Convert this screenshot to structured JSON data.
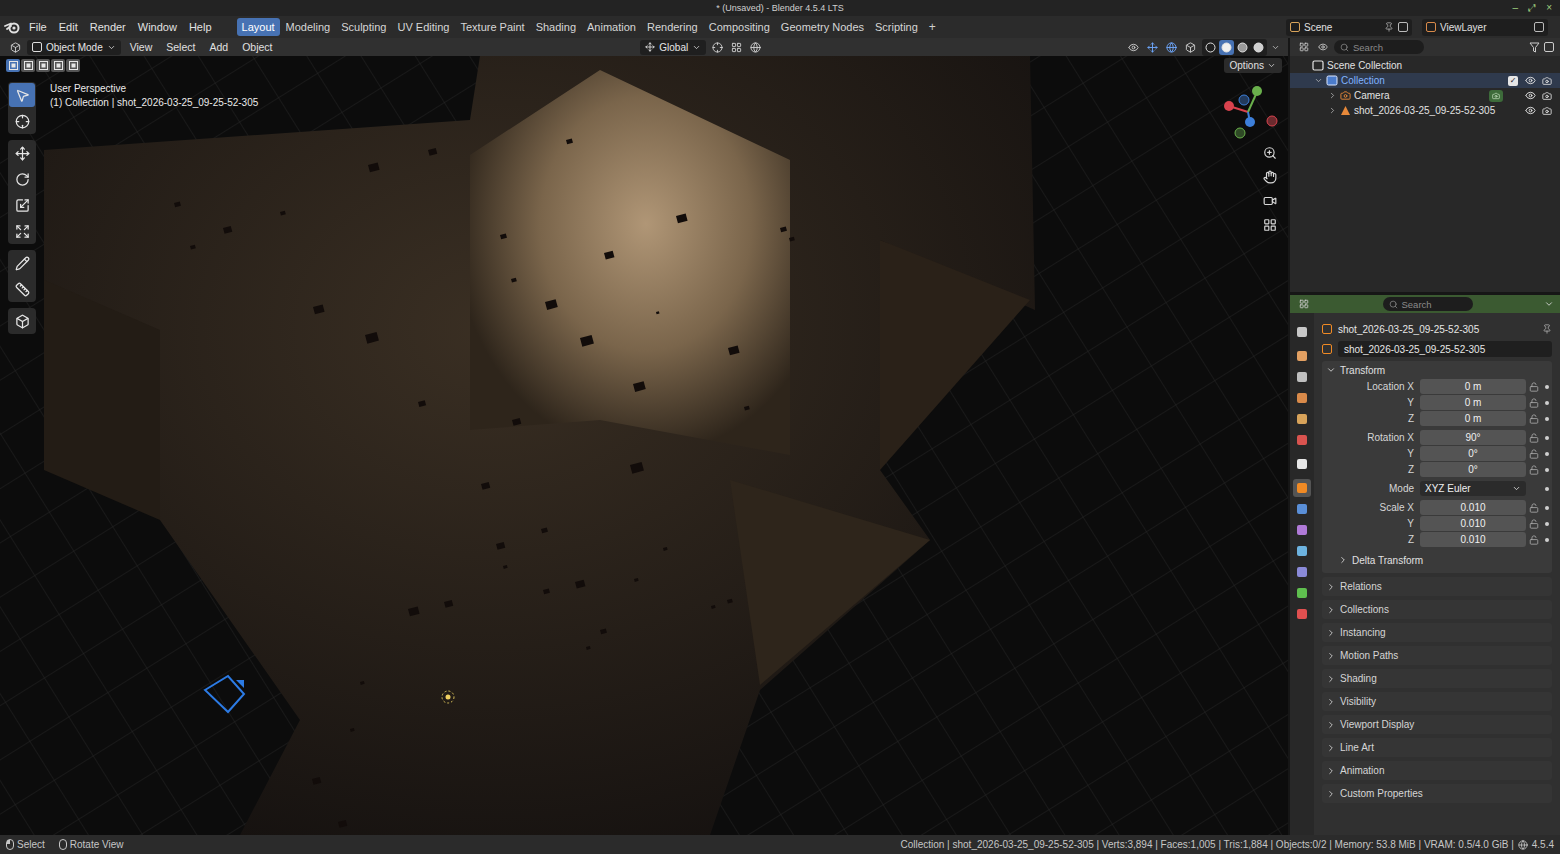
{
  "window": {
    "title": "* (Unsaved) - Blender 4.5.4 LTS",
    "controls": [
      "–",
      "⤢",
      "×"
    ]
  },
  "menubar": {
    "items": [
      "File",
      "Edit",
      "Render",
      "Window",
      "Help"
    ]
  },
  "workspace_tabs": [
    {
      "label": "Layout",
      "selected": true
    },
    {
      "label": "Modeling",
      "selected": false
    },
    {
      "label": "Sculpting",
      "selected": false
    },
    {
      "label": "UV Editing",
      "selected": false
    },
    {
      "label": "Texture Paint",
      "selected": false
    },
    {
      "label": "Shading",
      "selected": false
    },
    {
      "label": "Animation",
      "selected": false
    },
    {
      "label": "Rendering",
      "selected": false
    },
    {
      "label": "Compositing",
      "selected": false
    },
    {
      "label": "Geometry Nodes",
      "selected": false
    },
    {
      "label": "Scripting",
      "selected": false
    }
  ],
  "add_workspace": "+",
  "scene_selector": {
    "scene": "Scene",
    "view_layer": "ViewLayer"
  },
  "viewport": {
    "mode": "Object Mode",
    "menus": [
      "View",
      "Select",
      "Add",
      "Object"
    ],
    "orientation": "Global",
    "options": "Options",
    "view_name": "User Perspective",
    "context": "(1) Collection | shot_2026-03-25_09-25-52-305",
    "select_modes": [
      {
        "selected": true
      },
      {
        "selected": false
      },
      {
        "selected": false
      },
      {
        "selected": false
      },
      {
        "selected": false
      }
    ],
    "tool_groups": [
      [
        {
          "kind": "select-box",
          "selected": true
        },
        {
          "kind": "cursor",
          "selected": false
        }
      ],
      [
        {
          "kind": "move",
          "selected": false
        },
        {
          "kind": "rotate",
          "selected": false
        },
        {
          "kind": "scale",
          "selected": false
        },
        {
          "kind": "transform",
          "selected": false
        }
      ],
      [
        {
          "kind": "annotate",
          "selected": false
        },
        {
          "kind": "measure",
          "selected": false
        }
      ],
      [
        {
          "kind": "add-cube",
          "selected": false
        }
      ]
    ],
    "navigation": [
      {
        "kind": "zoom"
      },
      {
        "kind": "pan"
      },
      {
        "kind": "camera"
      },
      {
        "kind": "ortho"
      }
    ],
    "shading_modes": [
      {
        "kind": "wireframe",
        "selected": false
      },
      {
        "kind": "solid",
        "selected": true
      },
      {
        "kind": "material",
        "selected": false
      },
      {
        "kind": "rendered",
        "selected": false
      }
    ]
  },
  "outliner": {
    "search_placeholder": "Search",
    "rows": [
      {
        "label": "Scene Collection",
        "depth": 0,
        "kind": "scene-collection",
        "expandable": false,
        "expanded": false,
        "selected": false,
        "toggles": false,
        "has_include": false,
        "included": false,
        "visible": false,
        "renderable": false,
        "data_badge": false
      },
      {
        "label": "Collection",
        "depth": 1,
        "kind": "collection",
        "expandable": true,
        "expanded": true,
        "selected": true,
        "toggles": true,
        "has_include": true,
        "included": true,
        "visible": true,
        "renderable": true,
        "data_badge": false
      },
      {
        "label": "Camera",
        "depth": 2,
        "kind": "camera",
        "expandable": true,
        "expanded": false,
        "selected": false,
        "toggles": true,
        "has_include": false,
        "included": false,
        "visible": true,
        "renderable": true,
        "data_badge": true
      },
      {
        "label": "shot_2026-03-25_09-25-52-305",
        "depth": 2,
        "kind": "mesh",
        "expandable": true,
        "expanded": false,
        "selected": false,
        "toggles": true,
        "has_include": false,
        "included": false,
        "visible": true,
        "renderable": true,
        "data_badge": false
      }
    ]
  },
  "properties": {
    "search_placeholder": "Search",
    "tab_groups": [
      [
        {
          "kind": "tool",
          "color": "#c8c8c8",
          "selected": false
        }
      ],
      [
        {
          "kind": "render",
          "color": "#e3a062",
          "selected": false
        },
        {
          "kind": "output",
          "color": "#bfbfbf",
          "selected": false
        },
        {
          "kind": "view-layer",
          "color": "#d98a4a",
          "selected": false
        },
        {
          "kind": "scene",
          "color": "#d8a35a",
          "selected": false
        },
        {
          "kind": "world",
          "color": "#d9534f",
          "selected": false
        }
      ],
      [
        {
          "kind": "collection",
          "color": "#e6e6e6",
          "selected": false
        }
      ],
      [
        {
          "kind": "object",
          "color": "#f08a24",
          "selected": true
        },
        {
          "kind": "modifiers",
          "color": "#5a8fd8",
          "selected": false
        },
        {
          "kind": "particles",
          "color": "#b07ad8",
          "selected": false
        },
        {
          "kind": "physics",
          "color": "#6db3e0",
          "selected": false
        },
        {
          "kind": "constraints",
          "color": "#8a8ad8",
          "selected": false
        },
        {
          "kind": "data",
          "color": "#5fbf4f",
          "selected": false
        },
        {
          "kind": "material",
          "color": "#e05050",
          "selected": false
        }
      ]
    ],
    "object_name": "shot_2026-03-25_09-25-52-305",
    "datablock_name": "shot_2026-03-25_09-25-52-305",
    "transform": {
      "title": "Transform",
      "expanded": true,
      "groups": [
        [
          {
            "label": "Location X",
            "value": "0 m",
            "kind": "number",
            "locked": false
          },
          {
            "label": "Y",
            "value": "0 m",
            "kind": "number",
            "locked": false
          },
          {
            "label": "Z",
            "value": "0 m",
            "kind": "number",
            "locked": false
          }
        ],
        [
          {
            "label": "Rotation X",
            "value": "90°",
            "kind": "number",
            "locked": false
          },
          {
            "label": "Y",
            "value": "0°",
            "kind": "number",
            "locked": false
          },
          {
            "label": "Z",
            "value": "0°",
            "kind": "number",
            "locked": false
          }
        ],
        [
          {
            "label": "Mode",
            "value": "XYZ Euler",
            "kind": "dropdown",
            "locked": false
          }
        ],
        [
          {
            "label": "Scale X",
            "value": "0.010",
            "kind": "number",
            "locked": false
          },
          {
            "label": "Y",
            "value": "0.010",
            "kind": "number",
            "locked": false
          },
          {
            "label": "Z",
            "value": "0.010",
            "kind": "number",
            "locked": false
          }
        ]
      ],
      "subpanels": [
        {
          "label": "Delta Transform",
          "expanded": false
        }
      ]
    },
    "panels": [
      {
        "label": "Relations",
        "expanded": false
      },
      {
        "label": "Collections",
        "expanded": false
      },
      {
        "label": "Instancing",
        "expanded": false
      },
      {
        "label": "Motion Paths",
        "expanded": false
      },
      {
        "label": "Shading",
        "expanded": false
      },
      {
        "label": "Visibility",
        "expanded": false
      },
      {
        "label": "Viewport Display",
        "expanded": false
      },
      {
        "label": "Line Art",
        "expanded": false
      },
      {
        "label": "Animation",
        "expanded": false
      },
      {
        "label": "Custom Properties",
        "expanded": false
      }
    ]
  },
  "status_bar": {
    "hints": [
      {
        "kind": "left-mouse",
        "label": "Select"
      },
      {
        "kind": "middle-mouse",
        "label": "Rotate View"
      }
    ],
    "info": "Collection | shot_2026-03-25_09-25-52-305 | Verts:3,894 | Faces:1,005 | Tris:1,884 | Objects:0/2 | Memory: 53.8 MiB | VRAM: 0.5/4.0 GiB |",
    "version": "4.5.4"
  }
}
